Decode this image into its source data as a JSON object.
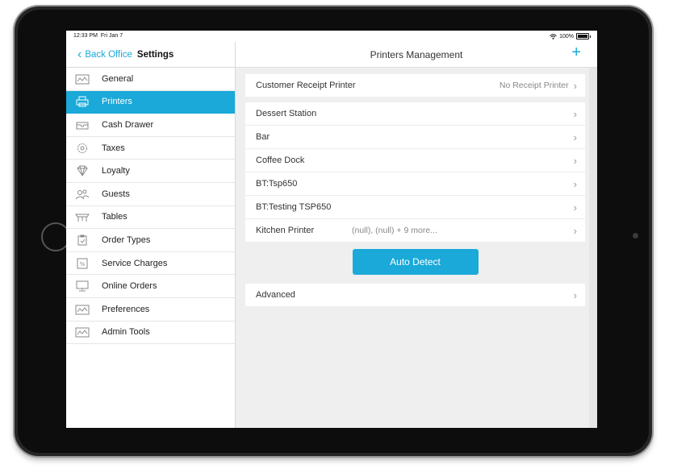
{
  "status": {
    "time": "12:33 PM",
    "date": "Fri Jan 7",
    "battery": "100%"
  },
  "sidebar": {
    "back_label": "Back Office",
    "title": "Settings",
    "items": [
      {
        "label": "General",
        "icon": "general-icon"
      },
      {
        "label": "Printers",
        "icon": "printer-icon"
      },
      {
        "label": "Cash Drawer",
        "icon": "cash-drawer-icon"
      },
      {
        "label": "Taxes",
        "icon": "taxes-icon"
      },
      {
        "label": "Loyalty",
        "icon": "diamond-icon"
      },
      {
        "label": "Guests",
        "icon": "guests-icon"
      },
      {
        "label": "Tables",
        "icon": "table-icon"
      },
      {
        "label": "Order Types",
        "icon": "clipboard-icon"
      },
      {
        "label": "Service Charges",
        "icon": "percent-icon"
      },
      {
        "label": "Online Orders",
        "icon": "monitor-icon"
      },
      {
        "label": "Preferences",
        "icon": "preferences-icon"
      },
      {
        "label": "Admin Tools",
        "icon": "admin-tools-icon"
      }
    ],
    "active_item": "Printers"
  },
  "main": {
    "title": "Printers Management",
    "add_label": "+",
    "receipt": {
      "label": "Customer Receipt Printer",
      "value": "No Receipt Printer"
    },
    "printers": [
      {
        "label": "Dessert Station",
        "sub": ""
      },
      {
        "label": "Bar",
        "sub": ""
      },
      {
        "label": "Coffee Dock",
        "sub": ""
      },
      {
        "label": "BT:Tsp650",
        "sub": ""
      },
      {
        "label": "BT:Testing TSP650",
        "sub": ""
      },
      {
        "label": "Kitchen Printer",
        "sub": "(null), (null) + 9 more..."
      }
    ],
    "auto_detect_label": "Auto Detect",
    "advanced_label": "Advanced"
  },
  "colors": {
    "accent": "#1aa9d9",
    "background": "#efefef"
  }
}
